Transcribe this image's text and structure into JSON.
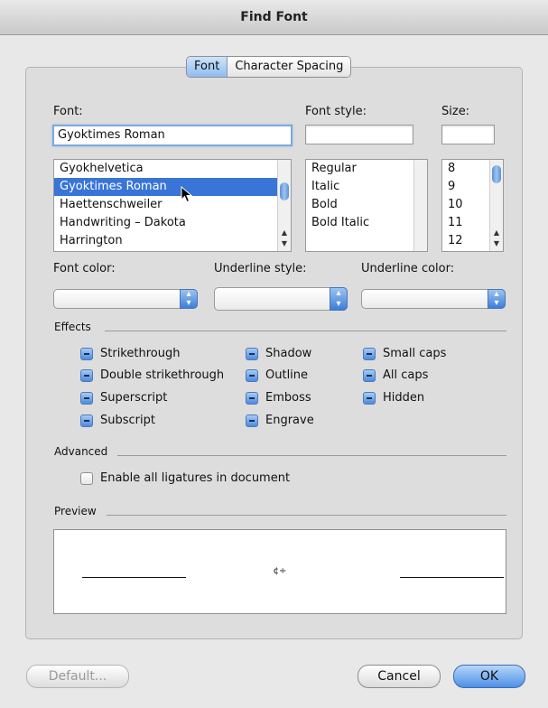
{
  "window": {
    "title": "Find Font"
  },
  "tabs": {
    "font": "Font",
    "character_spacing": "Character Spacing"
  },
  "font": {
    "label": "Font:",
    "value": "Gyoktimes Roman",
    "list": [
      "Gyokhelvetica",
      "Gyoktimes Roman",
      "Haettenschweiler",
      "Handwriting – Dakota",
      "Harrington"
    ],
    "selected_index": 1
  },
  "font_style": {
    "label": "Font style:",
    "value": "",
    "list": [
      "Regular",
      "Italic",
      "Bold",
      "Bold Italic"
    ]
  },
  "size": {
    "label": "Size:",
    "value": "",
    "list": [
      "8",
      "9",
      "10",
      "11",
      "12"
    ]
  },
  "colors": {
    "font_color_label": "Font color:",
    "underline_style_label": "Underline style:",
    "underline_color_label": "Underline color:"
  },
  "effects": {
    "label": "Effects",
    "col1": [
      "Strikethrough",
      "Double strikethrough",
      "Superscript",
      "Subscript"
    ],
    "col2": [
      "Shadow",
      "Outline",
      "Emboss",
      "Engrave"
    ],
    "col3": [
      "Small caps",
      "All caps",
      "Hidden"
    ]
  },
  "advanced": {
    "label": "Advanced",
    "ligatures": "Enable all ligatures in document"
  },
  "preview": {
    "label": "Preview",
    "text": "¢÷"
  },
  "buttons": {
    "default": "Default...",
    "cancel": "Cancel",
    "ok": "OK"
  },
  "accent_color": "#3875d7"
}
